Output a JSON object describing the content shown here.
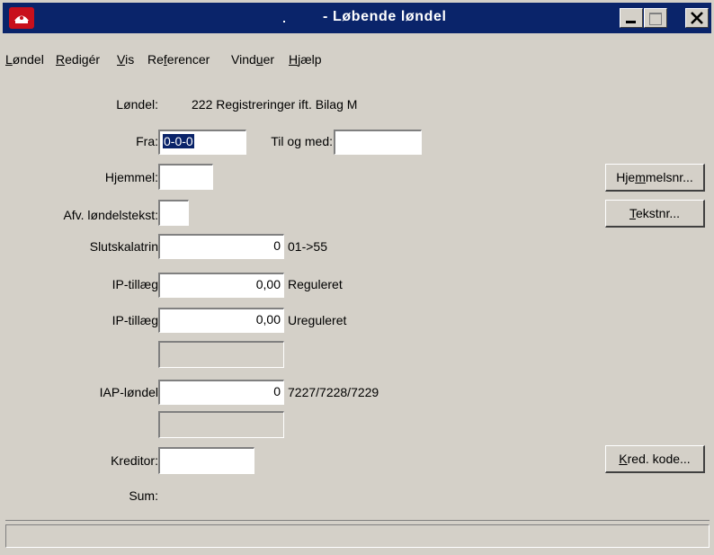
{
  "window": {
    "title": "- Løbende løndel",
    "controls": {
      "minimize": "_",
      "maximize": "□",
      "close": "X"
    }
  },
  "menu": [
    {
      "label": "Løndel",
      "accel": "L"
    },
    {
      "label": "Redigér",
      "accel": "R"
    },
    {
      "label": "Vis",
      "accel": "V"
    },
    {
      "label": "Referencer",
      "accel": "f"
    },
    {
      "label": "Vinduer",
      "accel": "u"
    },
    {
      "label": "Hjælp",
      "accel": "H"
    }
  ],
  "form": {
    "loendel_label": "Løndel:",
    "loendel_value": "222 Registreringer ift. Bilag M",
    "fra_label": "Fra:",
    "fra_value": "0-0-0",
    "til_label": "Til og med:",
    "til_value": "",
    "hjemmel_label": "Hjemmel:",
    "hjemmel_value": "",
    "afv_label": "Afv. løndelstekst:",
    "afv_value": "",
    "slutskala_label": "Slutskalatrin",
    "slutskala_value": "0",
    "slutskala_hint": "01->55",
    "ip1_label": "IP-tillæg",
    "ip1_value": "0,00",
    "ip1_hint": "Reguleret",
    "ip2_label": "IP-tillæg",
    "ip2_value": "0,00",
    "ip2_hint": "Ureguleret",
    "blank1_value": "",
    "iap_label": "IAP-løndel",
    "iap_value": "0",
    "iap_hint": "7227/7228/7229",
    "blank2_value": "",
    "kreditor_label": "Kreditor:",
    "kreditor_value": "",
    "sum_label": "Sum:"
  },
  "buttons": {
    "hjemmelsnr": {
      "pre": "Hje",
      "accel": "m",
      "post": "melsnr..."
    },
    "tekstnr": {
      "pre": "",
      "accel": "T",
      "post": "ekstnr..."
    },
    "kred_kode": {
      "pre": "",
      "accel": "K",
      "post": "red. kode..."
    }
  },
  "status": {
    "text": ""
  },
  "colors": {
    "titlebar": "#0a246a",
    "face": "#d4d0c8",
    "icon_bg": "#c8101c"
  }
}
